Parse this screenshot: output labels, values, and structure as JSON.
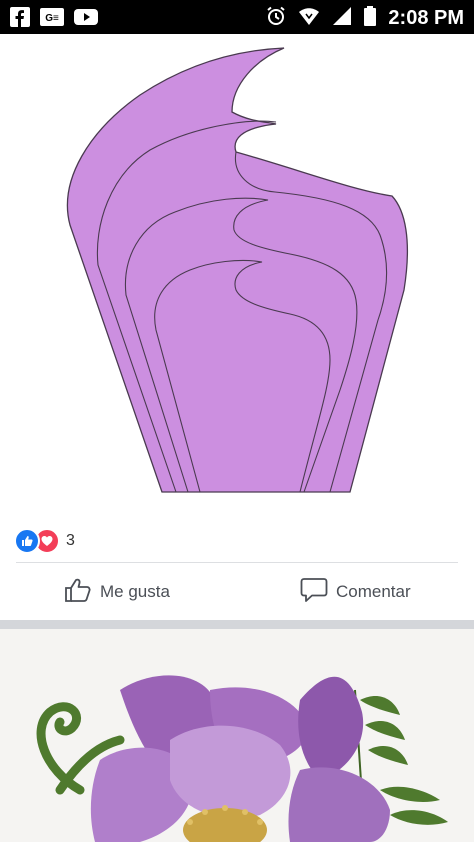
{
  "statusbar": {
    "time": "2:08 PM",
    "left_icons": [
      "facebook-icon",
      "news-icon",
      "youtube-icon"
    ],
    "right_icons": [
      "alarm-icon",
      "wifi-icon",
      "signal-icon",
      "battery-icon"
    ]
  },
  "post": {
    "image_desc": "purple-petal-template",
    "reaction_count": "3",
    "like_label": "Me gusta",
    "comment_label": "Comentar"
  },
  "colors": {
    "petal": "#cc8fe0",
    "petal_stroke": "#4a3a50",
    "like_blue": "#1877f2",
    "love_red": "#f33e58",
    "action_text": "#4b4f56"
  }
}
